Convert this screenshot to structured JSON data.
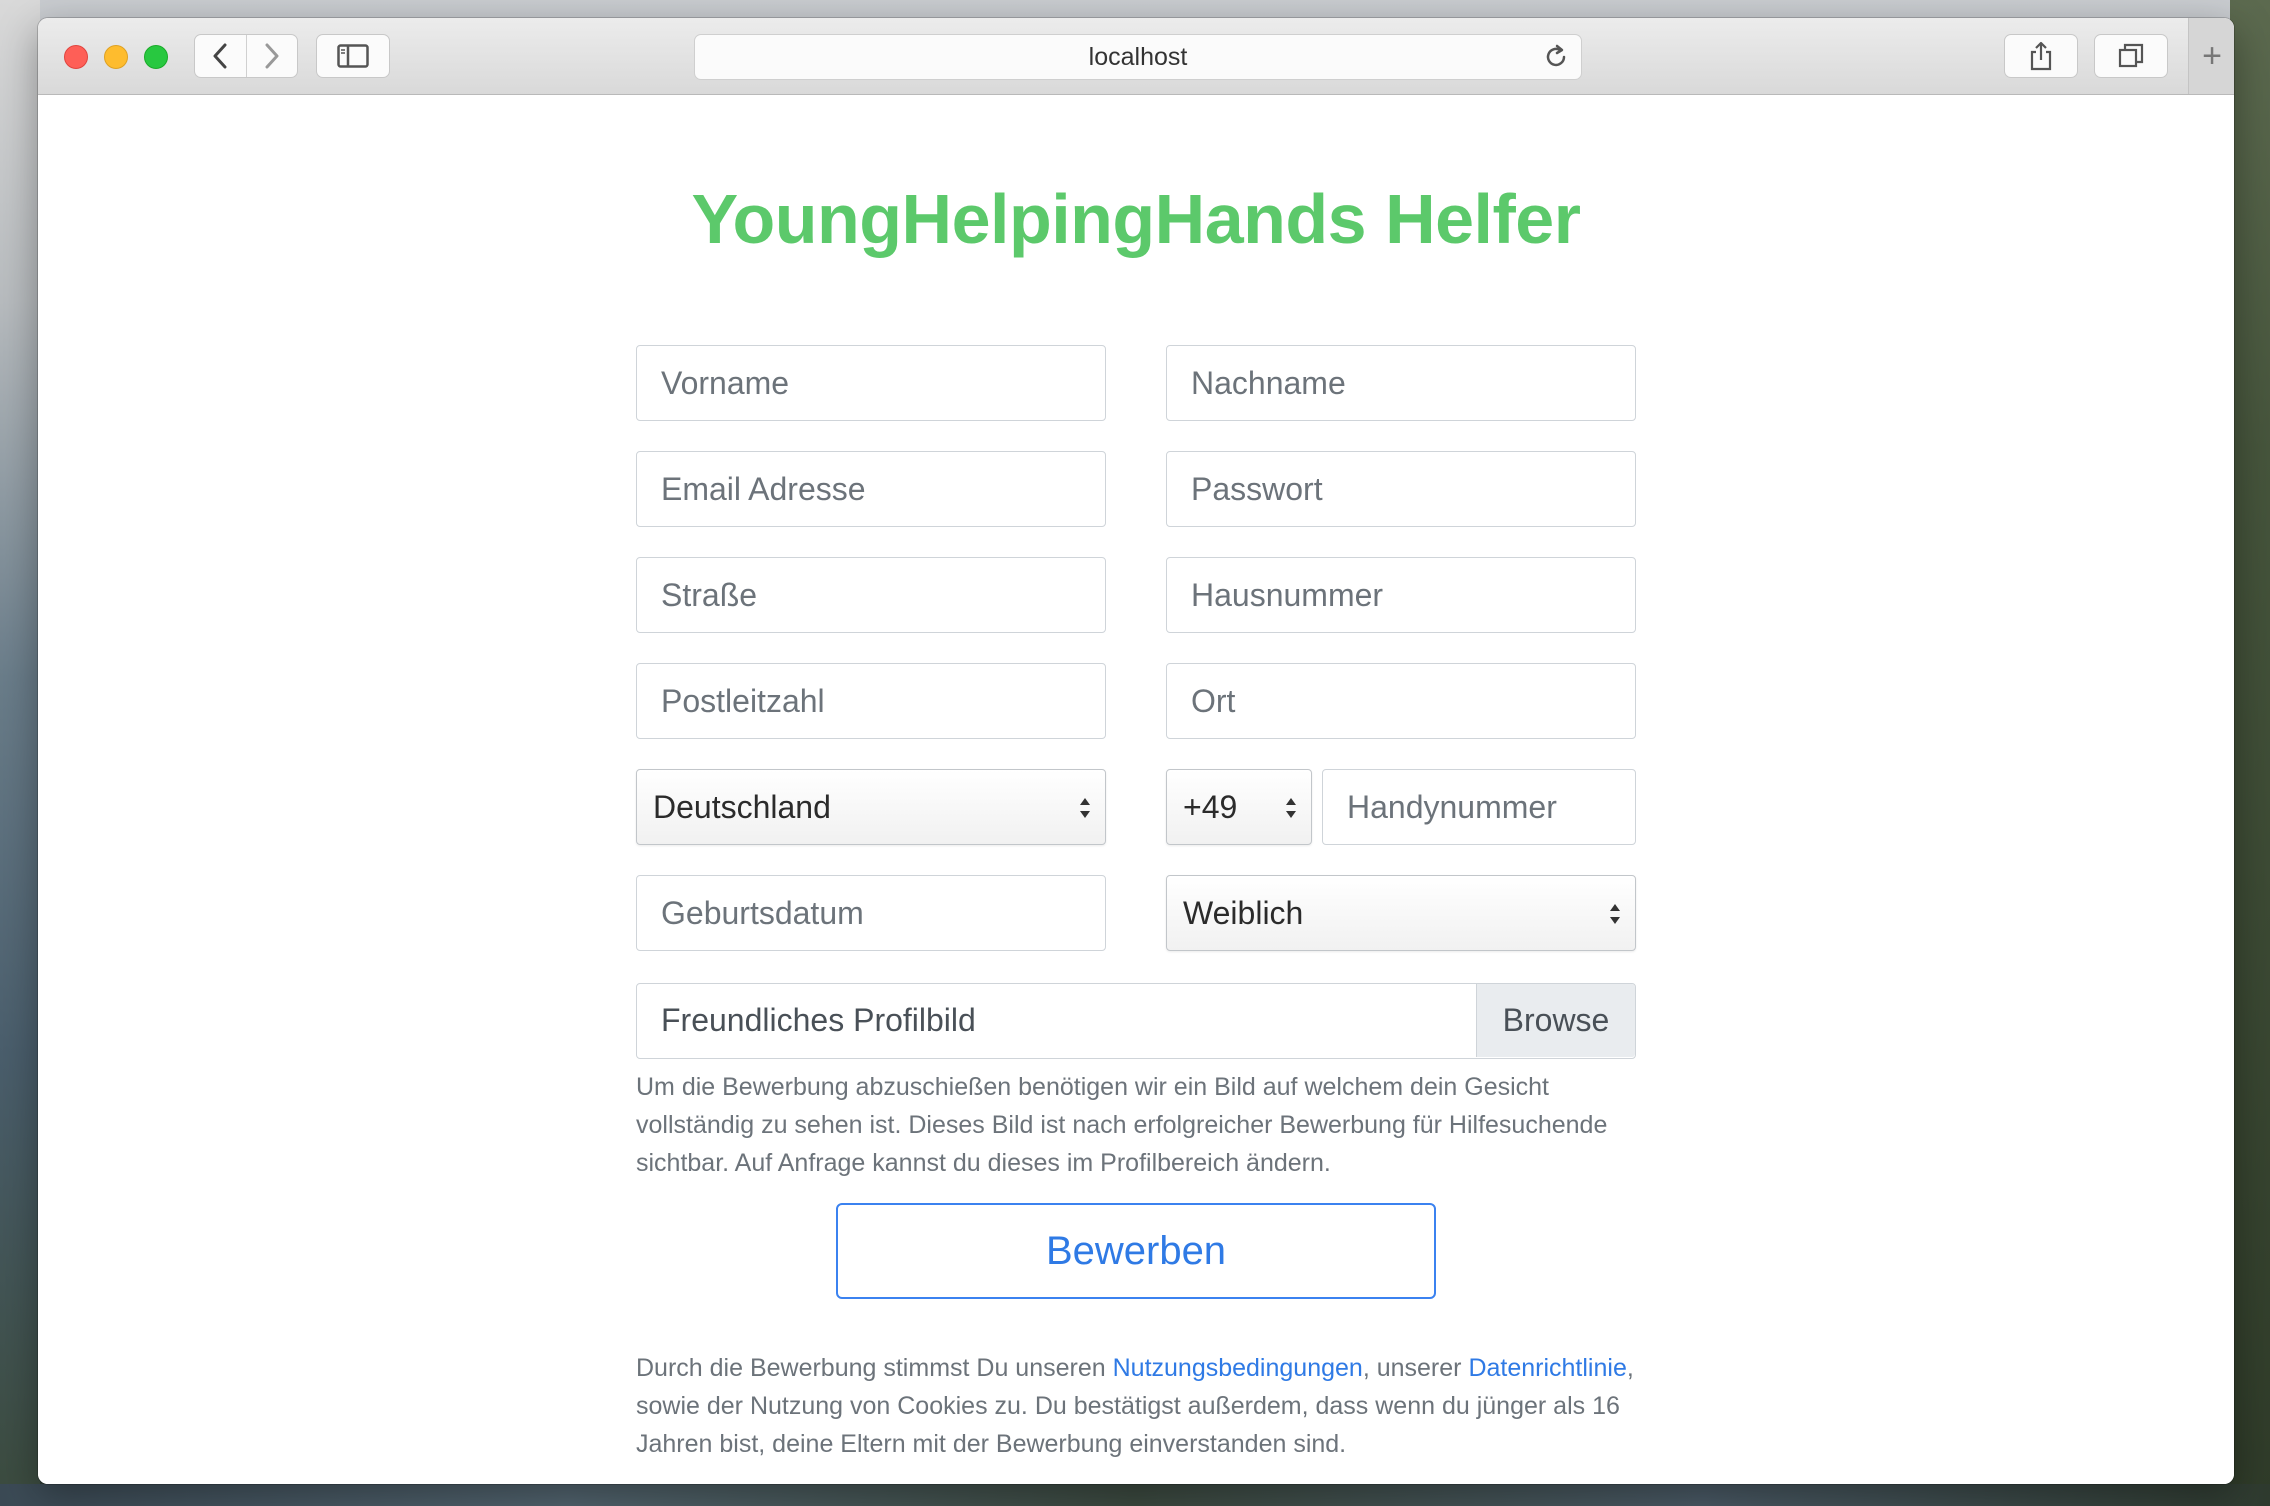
{
  "browser": {
    "url": "localhost",
    "new_tab_symbol": "+",
    "icons": {
      "back": "chevron-left-icon",
      "forward": "chevron-right-icon",
      "sidebar": "sidebar-icon",
      "reload": "reload-icon",
      "share": "share-icon",
      "tabs": "tabs-icon"
    }
  },
  "page": {
    "title": "YoungHelpingHands Helfer",
    "title_color": "#5cc96b",
    "accent_color": "#2f7ae5"
  },
  "form": {
    "first_name_placeholder": "Vorname",
    "last_name_placeholder": "Nachname",
    "email_placeholder": "Email Adresse",
    "password_placeholder": "Passwort",
    "street_placeholder": "Straße",
    "house_number_placeholder": "Hausnummer",
    "postal_code_placeholder": "Postleitzahl",
    "city_placeholder": "Ort",
    "country_selected": "Deutschland",
    "phone_prefix_selected": "+49",
    "phone_placeholder": "Handynummer",
    "birthdate_placeholder": "Geburtsdatum",
    "gender_selected": "Weiblich",
    "profile_picture_label": "Freundliches Profilbild",
    "browse_label": "Browse",
    "help_text": "Um die Bewerbung abzuschießen benötigen wir ein Bild auf welchem dein Gesicht vollständig zu sehen ist. Dieses Bild ist nach erfolgreicher Bewerbung für Hilfesuchende sichtbar. Auf Anfrage kannst du dieses im Profilbereich ändern.",
    "submit_label": "Bewerben"
  },
  "terms": {
    "part1": "Durch die Bewerbung stimmst Du unseren ",
    "link_terms": "Nutzungsbedingungen",
    "part2": ", unserer ",
    "link_privacy": "Datenrichtlinie",
    "part3": ", sowie der Nutzung von Cookies zu. Du bestätigst außerdem, dass wenn du jünger als 16 Jahren bist, deine Eltern mit der Bewerbung einverstanden sind."
  }
}
